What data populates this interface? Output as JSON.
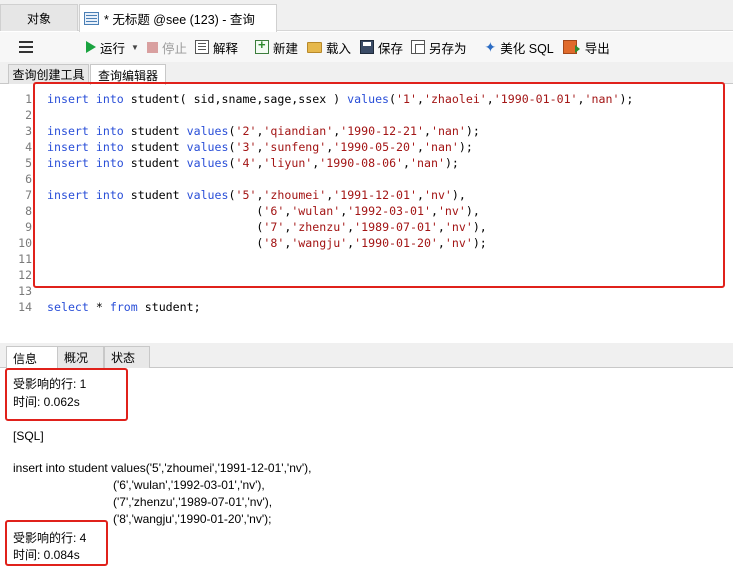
{
  "tabs": {
    "objects": "对象",
    "query": "* 无标题 @see (123) - 查询"
  },
  "toolbar": {
    "run": "运行",
    "stop": "停止",
    "explain": "解释",
    "new": "新建",
    "load": "载入",
    "save": "保存",
    "save_as": "另存为",
    "beautify": "美化 SQL",
    "export": "导出"
  },
  "subtabs": {
    "builder": "查询创建工具",
    "editor": "查询编辑器"
  },
  "editor": {
    "line_numbers": [
      "1",
      "2",
      "3",
      "4",
      "5",
      "6",
      "7",
      "8",
      "9",
      "10",
      "11",
      "12",
      "13",
      "14"
    ],
    "lines": [
      [
        {
          "t": "kw",
          "v": "insert into"
        },
        {
          "t": "plain",
          "v": " student( sid,sname,sage,ssex ) "
        },
        {
          "t": "kw",
          "v": "values"
        },
        {
          "t": "plain",
          "v": "("
        },
        {
          "t": "str",
          "v": "'1'"
        },
        {
          "t": "plain",
          "v": ","
        },
        {
          "t": "str",
          "v": "'zhaolei'"
        },
        {
          "t": "plain",
          "v": ","
        },
        {
          "t": "str",
          "v": "'1990-01-01'"
        },
        {
          "t": "plain",
          "v": ","
        },
        {
          "t": "str",
          "v": "'nan'"
        },
        {
          "t": "plain",
          "v": ");"
        }
      ],
      [],
      [
        {
          "t": "kw",
          "v": "insert into"
        },
        {
          "t": "plain",
          "v": " student "
        },
        {
          "t": "kw",
          "v": "values"
        },
        {
          "t": "plain",
          "v": "("
        },
        {
          "t": "str",
          "v": "'2'"
        },
        {
          "t": "plain",
          "v": ","
        },
        {
          "t": "str",
          "v": "'qiandian'"
        },
        {
          "t": "plain",
          "v": ","
        },
        {
          "t": "str",
          "v": "'1990-12-21'"
        },
        {
          "t": "plain",
          "v": ","
        },
        {
          "t": "str",
          "v": "'nan'"
        },
        {
          "t": "plain",
          "v": ");"
        }
      ],
      [
        {
          "t": "kw",
          "v": "insert into"
        },
        {
          "t": "plain",
          "v": " student "
        },
        {
          "t": "kw",
          "v": "values"
        },
        {
          "t": "plain",
          "v": "("
        },
        {
          "t": "str",
          "v": "'3'"
        },
        {
          "t": "plain",
          "v": ","
        },
        {
          "t": "str",
          "v": "'sunfeng'"
        },
        {
          "t": "plain",
          "v": ","
        },
        {
          "t": "str",
          "v": "'1990-05-20'"
        },
        {
          "t": "plain",
          "v": ","
        },
        {
          "t": "str",
          "v": "'nan'"
        },
        {
          "t": "plain",
          "v": ");"
        }
      ],
      [
        {
          "t": "kw",
          "v": "insert into"
        },
        {
          "t": "plain",
          "v": " student "
        },
        {
          "t": "kw",
          "v": "values"
        },
        {
          "t": "plain",
          "v": "("
        },
        {
          "t": "str",
          "v": "'4'"
        },
        {
          "t": "plain",
          "v": ","
        },
        {
          "t": "str",
          "v": "'liyun'"
        },
        {
          "t": "plain",
          "v": ","
        },
        {
          "t": "str",
          "v": "'1990-08-06'"
        },
        {
          "t": "plain",
          "v": ","
        },
        {
          "t": "str",
          "v": "'nan'"
        },
        {
          "t": "plain",
          "v": ");"
        }
      ],
      [],
      [
        {
          "t": "kw",
          "v": "insert into"
        },
        {
          "t": "plain",
          "v": " student "
        },
        {
          "t": "kw",
          "v": "values"
        },
        {
          "t": "plain",
          "v": "("
        },
        {
          "t": "str",
          "v": "'5'"
        },
        {
          "t": "plain",
          "v": ","
        },
        {
          "t": "str",
          "v": "'zhoumei'"
        },
        {
          "t": "plain",
          "v": ","
        },
        {
          "t": "str",
          "v": "'1991-12-01'"
        },
        {
          "t": "plain",
          "v": ","
        },
        {
          "t": "str",
          "v": "'nv'"
        },
        {
          "t": "plain",
          "v": "),"
        }
      ],
      [
        {
          "t": "plain",
          "v": "                              ("
        },
        {
          "t": "str",
          "v": "'6'"
        },
        {
          "t": "plain",
          "v": ","
        },
        {
          "t": "str",
          "v": "'wulan'"
        },
        {
          "t": "plain",
          "v": ","
        },
        {
          "t": "str",
          "v": "'1992-03-01'"
        },
        {
          "t": "plain",
          "v": ","
        },
        {
          "t": "str",
          "v": "'nv'"
        },
        {
          "t": "plain",
          "v": "),"
        }
      ],
      [
        {
          "t": "plain",
          "v": "                              ("
        },
        {
          "t": "str",
          "v": "'7'"
        },
        {
          "t": "plain",
          "v": ","
        },
        {
          "t": "str",
          "v": "'zhenzu'"
        },
        {
          "t": "plain",
          "v": ","
        },
        {
          "t": "str",
          "v": "'1989-07-01'"
        },
        {
          "t": "plain",
          "v": ","
        },
        {
          "t": "str",
          "v": "'nv'"
        },
        {
          "t": "plain",
          "v": "),"
        }
      ],
      [
        {
          "t": "plain",
          "v": "                              ("
        },
        {
          "t": "str",
          "v": "'8'"
        },
        {
          "t": "plain",
          "v": ","
        },
        {
          "t": "str",
          "v": "'wangju'"
        },
        {
          "t": "plain",
          "v": ","
        },
        {
          "t": "str",
          "v": "'1990-01-20'"
        },
        {
          "t": "plain",
          "v": ","
        },
        {
          "t": "str",
          "v": "'nv'"
        },
        {
          "t": "plain",
          "v": ");"
        }
      ],
      [],
      [],
      [],
      [
        {
          "t": "kw",
          "v": "select"
        },
        {
          "t": "plain",
          "v": " * "
        },
        {
          "t": "kw",
          "v": "from"
        },
        {
          "t": "plain",
          "v": " student;"
        }
      ]
    ]
  },
  "bottom_tabs": {
    "info": "信息",
    "overview": "概况",
    "status": "状态"
  },
  "output": {
    "lines": [
      "受影响的行: 1",
      "时间: 0.062s",
      "",
      "[SQL]",
      "",
      "insert into student values('5','zhoumei','1991-12-01','nv'),",
      "                              ('6','wulan','1992-03-01','nv'),",
      "                              ('7','zhenzu','1989-07-01','nv'),",
      "                              ('8','wangju','1990-01-20','nv');",
      "受影响的行: 4",
      "时间: 0.084s"
    ]
  },
  "colors": {
    "keyword": "#2a4fd8",
    "string": "#a31515",
    "highlight_box": "#e0211b",
    "run_icon": "#1aa340"
  }
}
